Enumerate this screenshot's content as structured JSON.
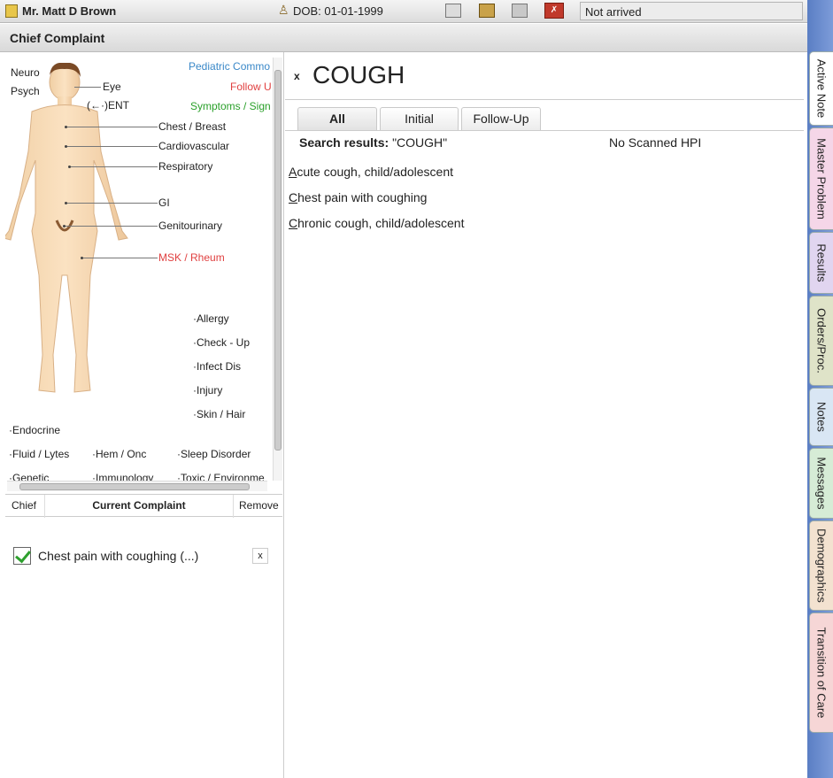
{
  "patient": {
    "name": "Mr. Matt D Brown",
    "dob": "DOB: 01-01-1999",
    "status": "Not arrived"
  },
  "right_tabs": [
    "Active Note",
    "Master Problem",
    "Results",
    "Orders/Proc.",
    "Notes",
    "Messages",
    "Demographics",
    "Transition of Care"
  ],
  "panel_title": "Chief Complaint",
  "body_map": {
    "neuro": "Neuro",
    "psych": "Psych",
    "eye": "Eye",
    "ent": "ENT",
    "chest_breast": "Chest / Breast",
    "cardiovascular": "Cardiovascular",
    "respiratory": "Respiratory",
    "gi": "GI",
    "genitourinary": "Genitourinary",
    "msk": "MSK / Rheum",
    "pediatric": "Pediatric Commo",
    "follow": "Follow U",
    "symptoms": "Symptoms / Sign",
    "allergy": "Allergy",
    "checkup": "Check - Up",
    "infect": "Infect Dis",
    "injury": "Injury",
    "skin": "Skin / Hair",
    "endocrine": "Endocrine",
    "fluid": "Fluid / Lytes",
    "hem": "Hem / Onc",
    "sleep": "Sleep Disorder",
    "genetic": "Genetic",
    "immunology": "Immunology",
    "toxic": "Toxic / Environme"
  },
  "complaint_table": {
    "col_chief": "Chief",
    "col_current": "Current Complaint",
    "col_remove": "Remove",
    "row_text": "Chest pain with coughing (...)",
    "row_remove": "x"
  },
  "search": {
    "clear": "x",
    "query": "COUGH"
  },
  "result_tabs": [
    "All",
    "Initial",
    "Follow-Up"
  ],
  "results_label": "Search results:",
  "results_query": "\"COUGH\"",
  "scanned_hpi": "No Scanned HPI",
  "results": [
    "Acute cough, child/adolescent",
    "Chest pain with coughing",
    "Chronic cough, child/adolescent"
  ]
}
